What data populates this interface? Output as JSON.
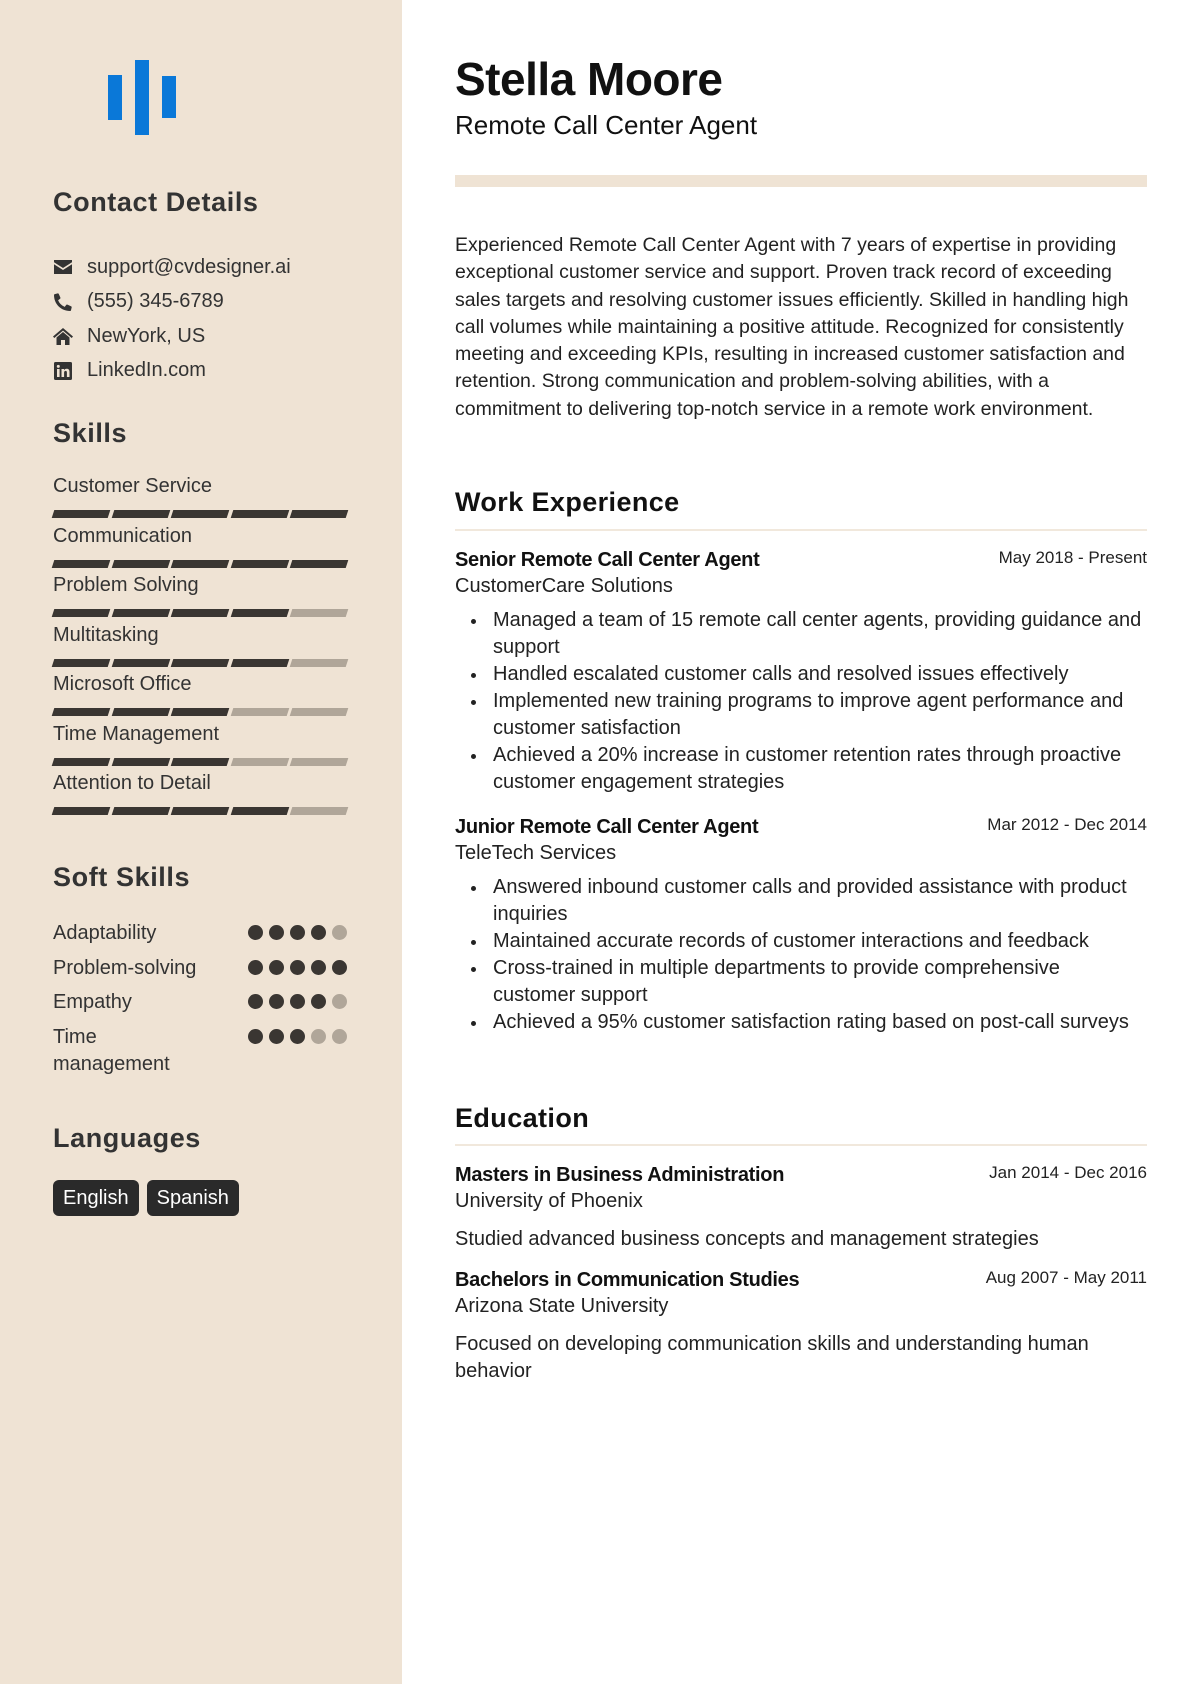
{
  "logo": {
    "icon": "sound-bars-icon",
    "color": "#0a78d8"
  },
  "sidebar": {
    "contact": {
      "heading": "Contact Details",
      "items": [
        {
          "icon": "envelope-icon",
          "text": "support@cvdesigner.ai"
        },
        {
          "icon": "phone-icon",
          "text": "(555) 345-6789"
        },
        {
          "icon": "home-icon",
          "text": "NewYork, US"
        },
        {
          "icon": "linkedin-icon",
          "text": "LinkedIn.com"
        }
      ]
    },
    "skills": {
      "heading": "Skills",
      "max": 5,
      "items": [
        {
          "name": "Customer Service",
          "level": 5
        },
        {
          "name": "Communication",
          "level": 5
        },
        {
          "name": "Problem Solving",
          "level": 4
        },
        {
          "name": "Multitasking",
          "level": 4
        },
        {
          "name": "Microsoft Office",
          "level": 3
        },
        {
          "name": "Time Management",
          "level": 3
        },
        {
          "name": "Attention to Detail",
          "level": 4
        }
      ]
    },
    "soft_skills": {
      "heading": "Soft Skills",
      "max": 5,
      "items": [
        {
          "name": "Adaptability",
          "level": 4
        },
        {
          "name": "Problem-solving",
          "level": 5
        },
        {
          "name": "Empathy",
          "level": 4
        },
        {
          "name": "Time management",
          "level": 3
        }
      ]
    },
    "languages": {
      "heading": "Languages",
      "items": [
        "English",
        "Spanish"
      ]
    }
  },
  "header": {
    "name": "Stella Moore",
    "title": "Remote Call Center Agent"
  },
  "summary": "Experienced Remote Call Center Agent with 7 years of expertise in providing exceptional customer service and support. Proven track record of exceeding sales targets and resolving customer issues efficiently. Skilled in handling high call volumes while maintaining a positive attitude. Recognized for consistently meeting and exceeding KPIs, resulting in increased customer satisfaction and retention. Strong communication and problem-solving abilities, with a commitment to delivering top-notch service in a remote work environment.",
  "work": {
    "heading": "Work Experience",
    "items": [
      {
        "title": "Senior Remote Call Center Agent",
        "company": "CustomerCare Solutions",
        "dates": "May 2018 - Present",
        "bullets": [
          "Managed a team of 15 remote call center agents, providing guidance and support",
          "Handled escalated customer calls and resolved issues effectively",
          "Implemented new training programs to improve agent performance and customer satisfaction",
          "Achieved a 20% increase in customer retention rates through proactive customer engagement strategies"
        ]
      },
      {
        "title": "Junior Remote Call Center Agent",
        "company": "TeleTech Services",
        "dates": "Mar 2012 - Dec 2014",
        "bullets": [
          "Answered inbound customer calls and provided assistance with product inquiries",
          "Maintained accurate records of customer interactions and feedback",
          "Cross-trained in multiple departments to provide comprehensive customer support",
          "Achieved a 95% customer satisfaction rating based on post-call surveys"
        ]
      }
    ]
  },
  "education": {
    "heading": "Education",
    "items": [
      {
        "degree": "Masters in Business Administration",
        "school": "University of Phoenix",
        "dates": "Jan 2014 - Dec 2016",
        "description": "Studied advanced business concepts and management strategies"
      },
      {
        "degree": "Bachelors in Communication Studies",
        "school": "Arizona State University",
        "dates": "Aug 2007 - May 2011",
        "description": "Focused on developing communication skills and understanding human behavior"
      }
    ]
  }
}
